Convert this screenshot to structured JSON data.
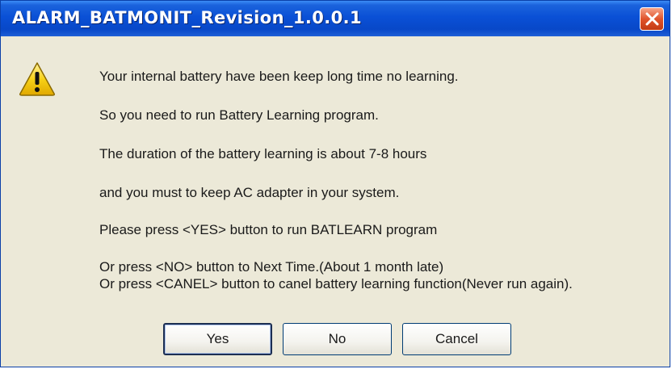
{
  "window": {
    "title": "ALARM_BATMONIT_Revision_1.0.0.1"
  },
  "icons": {
    "close": "close-icon",
    "warning": "warning-icon"
  },
  "message": {
    "line1": "Your internal battery have been keep long time no learning.",
    "line2": "So you need to run Battery Learning program.",
    "line3": "The duration of the battery learning is about 7-8 hours",
    "line4": "and you must to keep AC adapter in your system.",
    "line5": "Please press <YES> button to run BATLEARN program",
    "line6": "Or press <NO> button to Next Time.(About 1 month late)",
    "line7": "Or press <CANEL> button to canel battery learning function(Never run again)."
  },
  "buttons": {
    "yes": "Yes",
    "no": "No",
    "cancel": "Cancel"
  },
  "colors": {
    "titlebar": "#0a50d6",
    "close_button": "#e0542c",
    "dialog_background": "#ece9d8",
    "warning_yellow": "#f7d117"
  }
}
